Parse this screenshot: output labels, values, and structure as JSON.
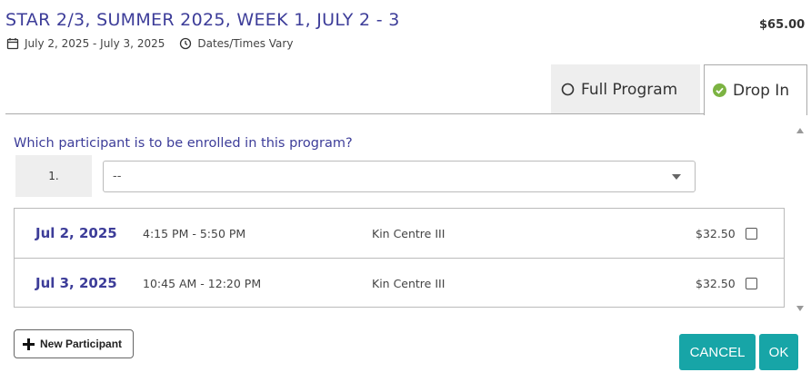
{
  "program": {
    "title": "STAR 2/3, SUMMER 2025, WEEK 1, JULY 2 - 3",
    "price": "$65.00",
    "date_range": "July 2, 2025 - July 3, 2025",
    "times": "Dates/Times Vary",
    "icons": {
      "date": "calendar-icon",
      "time": "clock-icon"
    }
  },
  "tabs": [
    {
      "label": "Full Program",
      "icon": "radio-empty-icon",
      "selected": false
    },
    {
      "label": "Drop In",
      "icon": "check-circle-icon",
      "selected": true
    }
  ],
  "enrollment": {
    "question": "Which participant is to be enrolled in this program?",
    "participant_number": "1.",
    "participant_select_value": "--"
  },
  "sessions": [
    {
      "date": "Jul 2, 2025",
      "time": "4:15 PM - 5:50 PM",
      "location": "Kin Centre III",
      "price": "$32.50",
      "checked": false
    },
    {
      "date": "Jul 3, 2025",
      "time": "10:45 AM - 12:20 PM",
      "location": "Kin Centre III",
      "price": "$32.50",
      "checked": false
    }
  ],
  "actions": {
    "new_participant": "New Participant",
    "cancel": "CANCEL",
    "ok": "OK"
  },
  "colors": {
    "title": "#3d3d99",
    "accent_button": "#17a5a7",
    "check_green": "#7cb342",
    "tab_inactive_bg": "#eeeeee"
  }
}
